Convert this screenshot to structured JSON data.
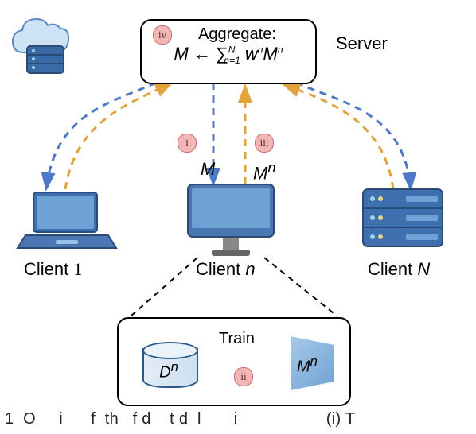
{
  "server": {
    "label": "Server",
    "aggregate_label": "Aggregate:",
    "formula_text": "M ← Σ_{n=1}^{N} w^n M^n"
  },
  "badges": {
    "i": "i",
    "ii": "ii",
    "iii": "iii",
    "iv": "iv"
  },
  "arrows": {
    "down_label": "M",
    "up_label": "M^n"
  },
  "clients": {
    "c1": "Client 1",
    "cn": "Client n",
    "cN": "Client N"
  },
  "train": {
    "label": "Train",
    "dataset": "D^n",
    "model": "M^n"
  }
}
